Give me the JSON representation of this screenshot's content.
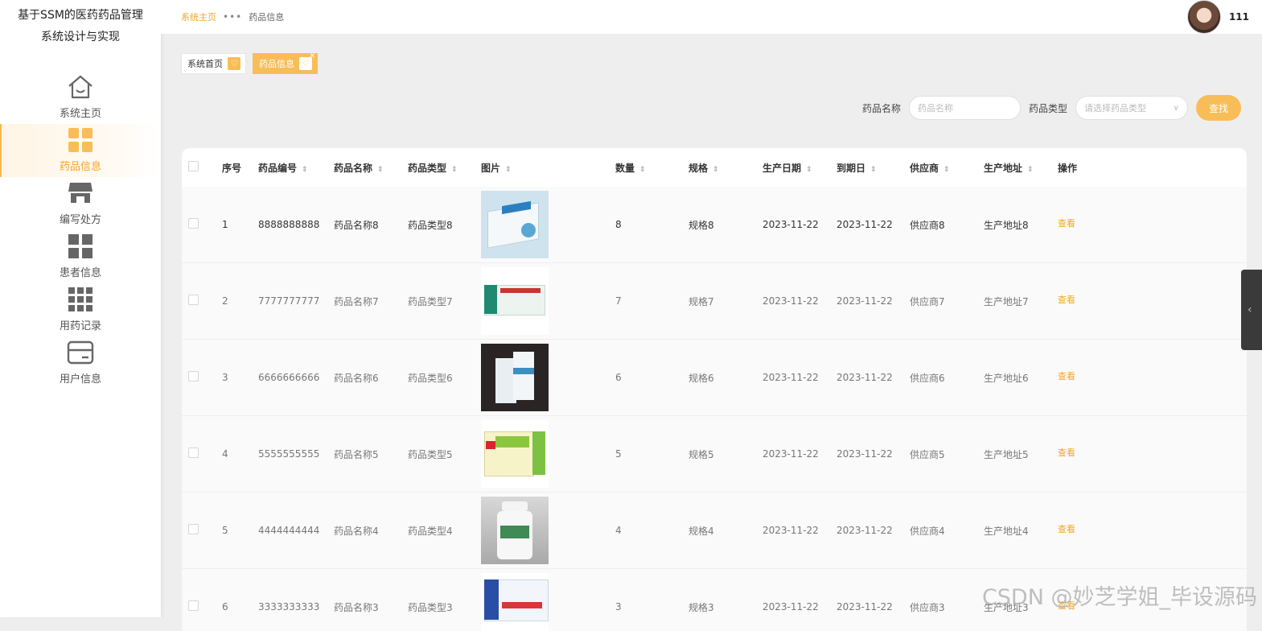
{
  "app": {
    "title": "基于SSM的医药药品管理系统设计与实现",
    "title_line1": "基于SSM的医药药品管理",
    "title_line2": "系统设计与实现"
  },
  "sidebar": {
    "items": [
      {
        "label": "系统主页",
        "icon": "home-icon"
      },
      {
        "label": "药品信息",
        "icon": "grid-icon"
      },
      {
        "label": "编写处方",
        "icon": "store-icon"
      },
      {
        "label": "患者信息",
        "icon": "apps-icon"
      },
      {
        "label": "用药记录",
        "icon": "grid9-icon"
      },
      {
        "label": "用户信息",
        "icon": "card-icon"
      }
    ]
  },
  "breadcrumb": {
    "home": "系统主页",
    "sep": "•••",
    "current": "药品信息"
  },
  "user": {
    "name": "111"
  },
  "tags": [
    {
      "label": "系统首页"
    },
    {
      "label": "药品信息"
    }
  ],
  "search": {
    "name_label": "药品名称",
    "name_placeholder": "药品名称",
    "type_label": "药品类型",
    "type_placeholder": "请选择药品类型",
    "button": "查找"
  },
  "table": {
    "headers": [
      "序号",
      "药品编号",
      "药品名称",
      "药品类型",
      "图片",
      "数量",
      "规格",
      "生产日期",
      "到期日",
      "供应商",
      "生产地址",
      "操作"
    ],
    "rows": [
      {
        "idx": "1",
        "code": "8888888888",
        "name": "药品名称8",
        "type": "药品类型8",
        "qty": "8",
        "spec": "规格8",
        "date": "2023-11-22",
        "exp": "2023-11-22",
        "supplier": "供应商8",
        "addr": "生产地址8",
        "op": "查看"
      },
      {
        "idx": "2",
        "code": "7777777777",
        "name": "药品名称7",
        "type": "药品类型7",
        "qty": "7",
        "spec": "规格7",
        "date": "2023-11-22",
        "exp": "2023-11-22",
        "supplier": "供应商7",
        "addr": "生产地址7",
        "op": "查看"
      },
      {
        "idx": "3",
        "code": "6666666666",
        "name": "药品名称6",
        "type": "药品类型6",
        "qty": "6",
        "spec": "规格6",
        "date": "2023-11-22",
        "exp": "2023-11-22",
        "supplier": "供应商6",
        "addr": "生产地址6",
        "op": "查看"
      },
      {
        "idx": "4",
        "code": "5555555555",
        "name": "药品名称5",
        "type": "药品类型5",
        "qty": "5",
        "spec": "规格5",
        "date": "2023-11-22",
        "exp": "2023-11-22",
        "supplier": "供应商5",
        "addr": "生产地址5",
        "op": "查看"
      },
      {
        "idx": "5",
        "code": "4444444444",
        "name": "药品名称4",
        "type": "药品类型4",
        "qty": "4",
        "spec": "规格4",
        "date": "2023-11-22",
        "exp": "2023-11-22",
        "supplier": "供应商4",
        "addr": "生产地址4",
        "op": "查看"
      },
      {
        "idx": "6",
        "code": "3333333333",
        "name": "药品名称3",
        "type": "药品类型3",
        "qty": "3",
        "spec": "规格3",
        "date": "2023-11-22",
        "exp": "2023-11-22",
        "supplier": "供应商3",
        "addr": "生产地址3",
        "op": "查看"
      }
    ]
  },
  "watermark": "CSDN @妙芝学姐_毕设源码",
  "colors": {
    "accent": "#f9bd58",
    "link": "#f5a623",
    "background": "#efeeef"
  }
}
